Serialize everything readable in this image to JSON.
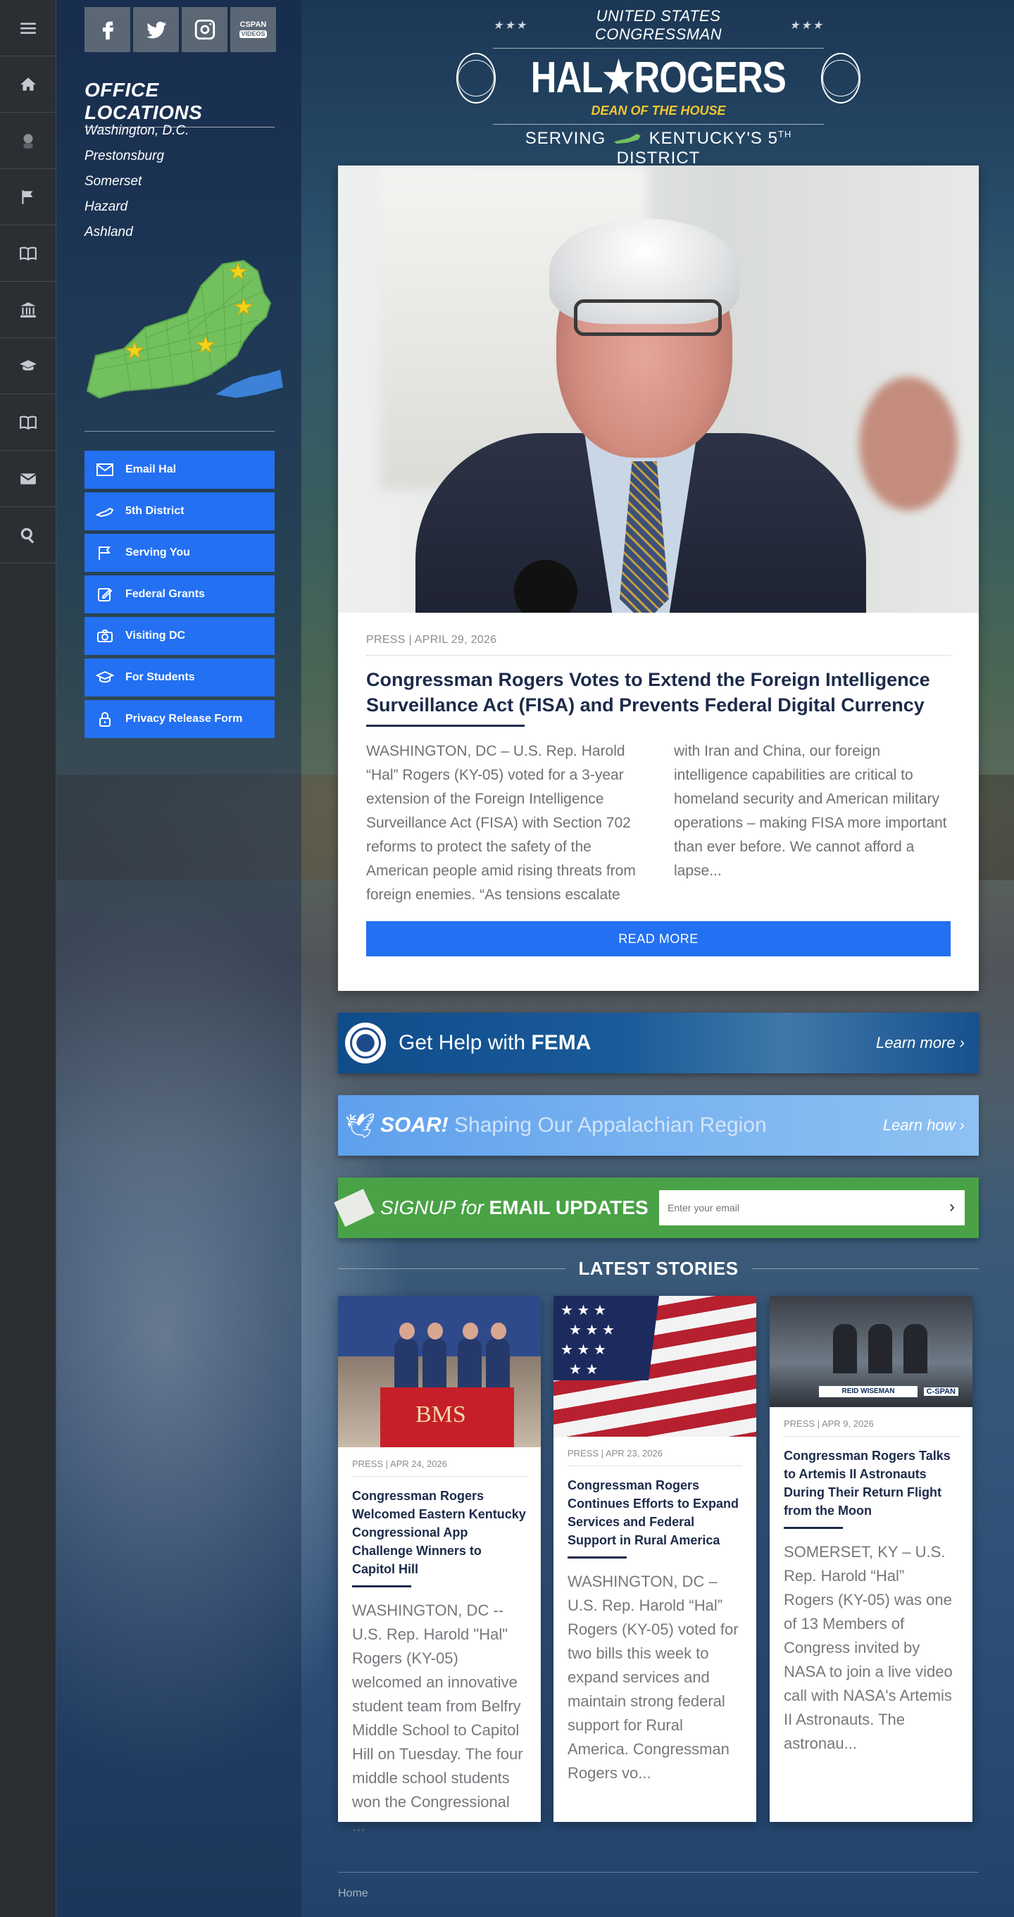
{
  "rail": {
    "items": [
      "menu-icon",
      "home-icon",
      "portrait-icon",
      "flag-icon",
      "book-icon",
      "capitol-icon",
      "graduation-cap-icon",
      "book-open-icon",
      "envelope-icon",
      "search-icon"
    ]
  },
  "social": {
    "items": [
      "facebook-icon",
      "twitter-icon",
      "instagram-icon",
      "cspan-icon"
    ],
    "cspan_top": "CSPAN",
    "cspan_bottom": "VIDEOS"
  },
  "offices": {
    "title_light": "OFFICE",
    "title_bold": "LOCATIONS",
    "locations": [
      "Washington, D.C.",
      "Prestonsburg",
      "Somerset",
      "Hazard",
      "Ashland"
    ]
  },
  "side_buttons": [
    {
      "label": "Email Hal",
      "icon": "envelope-icon"
    },
    {
      "label": "5th District",
      "icon": "kentucky-icon"
    },
    {
      "label": "Serving You",
      "icon": "flag-icon"
    },
    {
      "label": "Federal Grants",
      "icon": "edit-icon"
    },
    {
      "label": "Visiting DC",
      "icon": "camera-icon"
    },
    {
      "label": "For Students",
      "icon": "graduation-cap-icon"
    },
    {
      "label": "Privacy Release Form",
      "icon": "lock-icon"
    }
  ],
  "header": {
    "top": "UNITED STATES CONGRESSMAN",
    "name": "HAL★ROGERS",
    "dean": "DEAN OF THE HOUSE",
    "serving_pre": "SERVING",
    "serving_post": "KENTUCKY'S 5",
    "serving_sup": "TH",
    "serving_end": " DISTRICT"
  },
  "feature": {
    "meta": "PRESS | APRIL 29, 2026",
    "title": "Congressman Rogers Votes to Extend the Foreign Intelligence Surveillance Act (FISA) and Prevents Federal Digital Currency",
    "text": "WASHINGTON, DC – U.S. Rep. Harold “Hal” Rogers (KY-05) voted for a 3-year extension of the Foreign Intelligence Surveillance Act (FISA) with Section 702 reforms to protect the safety of the American people amid rising threats from foreign enemies. “As tensions escalate with Iran and China, our foreign intelligence capabilities are critical to homeland security and American military operations – making FISA more important than ever before. We cannot afford a lapse...",
    "button": "READ MORE"
  },
  "banners": {
    "fema_pre": "Get Help with ",
    "fema_bold": "FEMA",
    "fema_link": "Learn more  ›",
    "soar_bold": "SOAR!",
    "soar_rest": " Shaping Our Appalachian Region",
    "soar_link": "Learn how  ›",
    "signup_pre": "SIGNUP for ",
    "signup_bold": "EMAIL UPDATES",
    "signup_placeholder": "Enter your email"
  },
  "latest": {
    "heading": "LATEST STORIES",
    "stories": [
      {
        "meta": "PRESS | APR 24, 2026",
        "title": "Congressman Rogers Welcomed Eastern Kentucky Congressional App Challenge Winners to Capitol Hill",
        "text": "WASHINGTON, DC -- U.S. Rep. Harold \"Hal\" Rogers (KY-05) welcomed an innovative student team from Belfry Middle School to Capitol Hill on Tuesday. The four middle school students won the Congressional ...",
        "image_text": "BMS"
      },
      {
        "meta": "PRESS | APR 23, 2026",
        "title": "Congressman Rogers Continues Efforts to Expand Services and Federal Support in Rural America",
        "text": "WASHINGTON, DC – U.S. Rep. Harold “Hal” Rogers (KY-05) voted for two bills this week to expand services and maintain strong federal support for Rural America. Congressman Rogers vo..."
      },
      {
        "meta": "PRESS | APR 9, 2026",
        "title": "Congressman Rogers Talks to Artemis II Astronauts During Their Return Flight from the Moon",
        "text": "SOMERSET, KY – U.S. Rep. Harold “Hal” Rogers (KY-05) was one of 13 Members of Congress invited by NASA to join a live video call with NASA's Artemis II Astronauts. The astronau...",
        "image_caption": "REID WISEMAN",
        "image_logo": "C-SPAN"
      }
    ]
  },
  "footer": {
    "link": "Home"
  },
  "colors": {
    "accent_blue": "#2370f2",
    "navy_text": "#1c2a4a",
    "dean_gold": "#f1c62f",
    "signup_green": "#4aa246"
  }
}
